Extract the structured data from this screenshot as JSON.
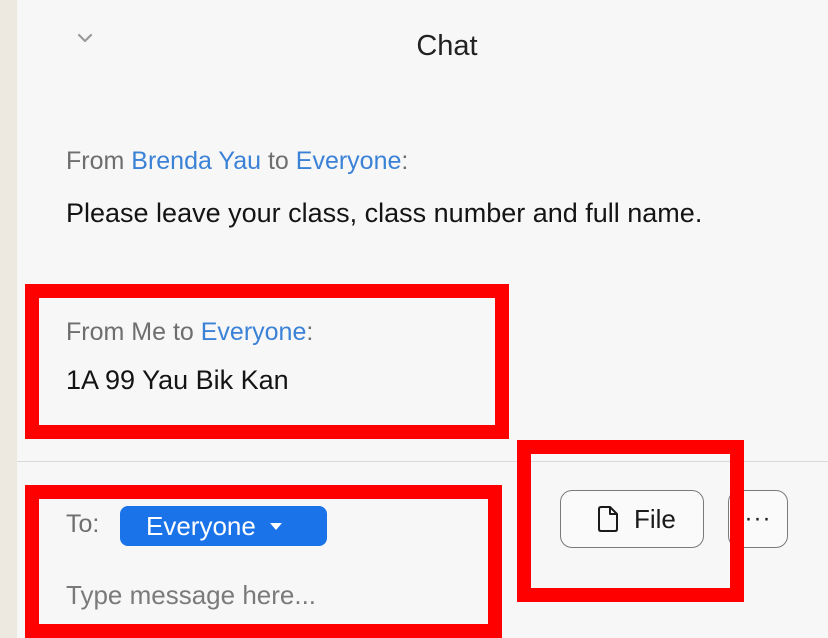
{
  "header": {
    "title": "Chat",
    "collapse_icon": "chevron-down-icon"
  },
  "messages": [
    {
      "from_prefix": "From ",
      "sender": "Brenda Yau",
      "to_word": " to ",
      "recipient": "Everyone",
      "colon": ":",
      "text": "Please leave your class, class number and full name."
    },
    {
      "from_prefix": "From Me",
      "to_word": " to ",
      "recipient": "Everyone",
      "colon": ":",
      "text": "1A 99 Yau Bik Kan"
    }
  ],
  "composer": {
    "to_label": "To:",
    "recipient": "Everyone",
    "placeholder": "Type message here...",
    "file_label": "File",
    "file_icon": "file-icon",
    "more_label": "···",
    "more_icon": "more-icon"
  },
  "colors": {
    "accent": "#1a73e8",
    "link": "#3b82d6",
    "highlight": "#ff0000",
    "panel_bg": "#f7f7f8",
    "page_bg": "#ede9e1"
  }
}
